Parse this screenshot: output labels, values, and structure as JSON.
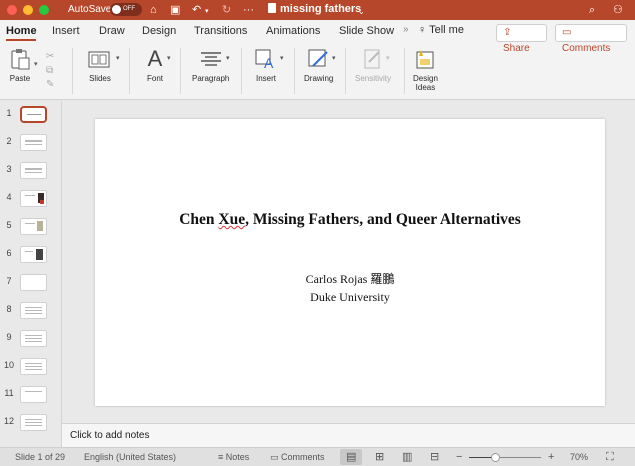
{
  "titlebar": {
    "autosave_label": "AutoSave",
    "autosave_state": "OFF",
    "doc_title": "missing fathers",
    "more": "···"
  },
  "ribbon": {
    "tabs": [
      "Home",
      "Insert",
      "Draw",
      "Design",
      "Transitions",
      "Animations",
      "Slide Show"
    ],
    "tell_me": "Tell me",
    "share": "Share",
    "comments": "Comments",
    "groups": {
      "paste": "Paste",
      "slides": "Slides",
      "font": "Font",
      "paragraph": "Paragraph",
      "insert": "Insert",
      "drawing": "Drawing",
      "sensitivity": "Sensitivity",
      "design_ideas_1": "Design",
      "design_ideas_2": "Ideas"
    }
  },
  "thumbnails": [
    "1",
    "2",
    "3",
    "4",
    "5",
    "6",
    "7",
    "8",
    "9",
    "10",
    "11",
    "12"
  ],
  "slide": {
    "title_part1": "Chen ",
    "title_squiggle": "Xue",
    "title_part2": ", Missing Fathers, and Queer Alternatives",
    "author": "Carlos Rojas 羅鵬",
    "affiliation": "Duke University"
  },
  "notes_placeholder": "Click to add notes",
  "statusbar": {
    "slide_info": "Slide 1 of 29",
    "language": "English (United States)",
    "notes": "Notes",
    "comments": "Comments",
    "zoom": "70%",
    "zoom_level": 0.38
  }
}
